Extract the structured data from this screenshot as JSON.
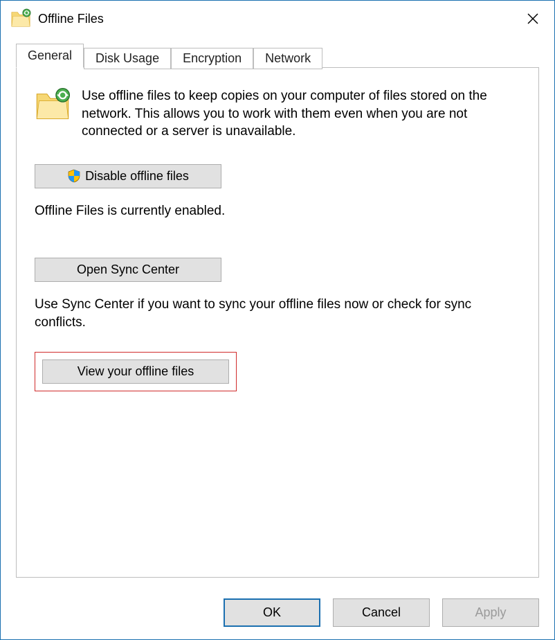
{
  "window": {
    "title": "Offline Files"
  },
  "tabs": {
    "general": "General",
    "disk_usage": "Disk Usage",
    "encryption": "Encryption",
    "network": "Network"
  },
  "content": {
    "intro": "Use offline files to keep copies on your computer of files stored on the network.  This allows you to work with them even when you are not connected or a server is unavailable.",
    "disable_btn": "Disable offline files",
    "status": "Offline Files is currently enabled.",
    "open_sync_btn": "Open Sync Center",
    "sync_desc": "Use Sync Center if you want to sync your offline files now or check for sync conflicts.",
    "view_btn": "View your offline files"
  },
  "footer": {
    "ok": "OK",
    "cancel": "Cancel",
    "apply": "Apply"
  }
}
